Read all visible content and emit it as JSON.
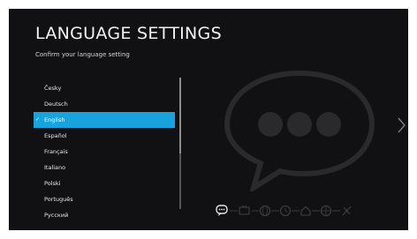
{
  "screen": {
    "title": "LANGUAGE SETTINGS",
    "subtitle": "Confirm your language setting"
  },
  "languages": [
    {
      "label": "Česky",
      "selected": false
    },
    {
      "label": "Deutsch",
      "selected": false
    },
    {
      "label": "English",
      "selected": true
    },
    {
      "label": "Español",
      "selected": false
    },
    {
      "label": "Français",
      "selected": false
    },
    {
      "label": "Italiano",
      "selected": false
    },
    {
      "label": "Polski",
      "selected": false
    },
    {
      "label": "Português",
      "selected": false
    },
    {
      "label": "Русский",
      "selected": false
    }
  ],
  "selected_check_icon": "checkmark-icon",
  "colors": {
    "background": "#111113",
    "highlight": "#19a3dc",
    "text": "#e8e8e8",
    "decoration": "#2a2a2c"
  },
  "setup_steps": {
    "total": 8,
    "current": 1,
    "icons": [
      "chat-icon",
      "tv-icon",
      "globe-icon",
      "clock-icon",
      "home-icon",
      "network-icon",
      "satellite-icon"
    ]
  },
  "decorative_icon": "speech-bubble-icon",
  "navigation_icon": "chevron-right-icon"
}
